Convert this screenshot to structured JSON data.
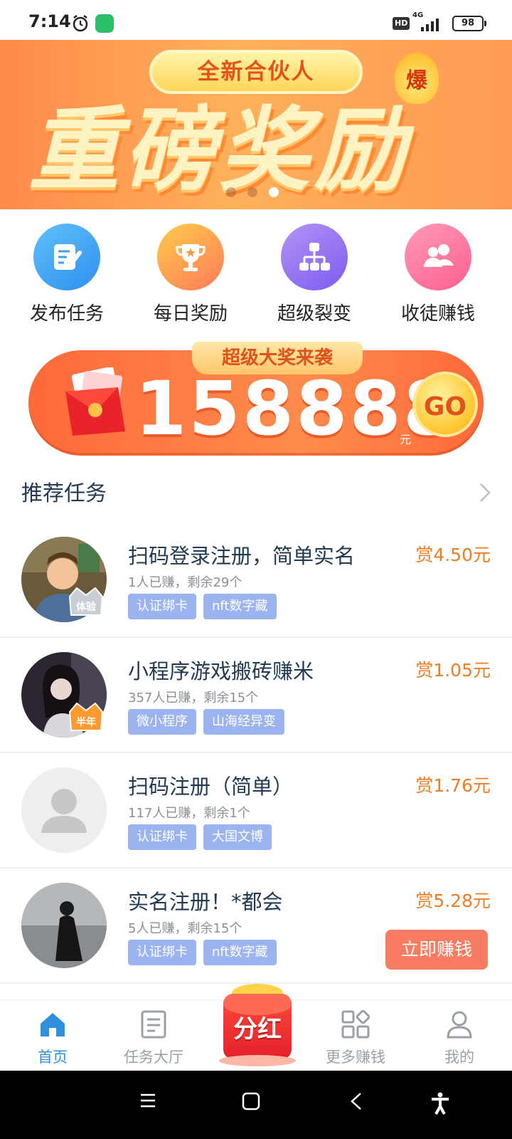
{
  "status_bar": {
    "time": "7:14",
    "hd": "HD",
    "network": "4G",
    "battery": "98"
  },
  "banner": {
    "ribbon": "全新合伙人",
    "burst": "爆",
    "headline": "重磅奖励"
  },
  "quick_menu": [
    {
      "label": "发布任务",
      "icon": "edit-note-icon",
      "color_from": "#5fc1f7",
      "color_to": "#2f8ff0"
    },
    {
      "label": "每日奖励",
      "icon": "trophy-icon",
      "color_from": "#ffcc4a",
      "color_to": "#ff7a5a"
    },
    {
      "label": "超级裂变",
      "icon": "network-icon",
      "color_from": "#b493f5",
      "color_to": "#7c5cf0"
    },
    {
      "label": "收徒赚钱",
      "icon": "users-icon",
      "color_from": "#ff9ab8",
      "color_to": "#ff5f8f"
    }
  ],
  "jackpot": {
    "tag": "超级大奖来袭",
    "amount": "158888",
    "unit": "元",
    "go": "GO"
  },
  "section": {
    "title": "推荐任务"
  },
  "tasks": [
    {
      "title": "扫码登录注册，简单实名",
      "meta": "1人已赚，剩余29个",
      "tags": [
        "认证绑卡",
        "nft数字藏"
      ],
      "reward": "赏4.50元",
      "badge": "体验"
    },
    {
      "title": "小程序游戏搬砖赚米",
      "meta": "357人已赚，剩余15个",
      "tags": [
        "微小程序",
        "山海经异变"
      ],
      "reward": "赏1.05元",
      "badge": "半年"
    },
    {
      "title": "扫码注册（简单）",
      "meta": "117人已赚，剩余1个",
      "tags": [
        "认证绑卡",
        "大国文博"
      ],
      "reward": "赏1.76元",
      "badge": ""
    },
    {
      "title": "实名注册！*都会",
      "meta": "5人已赚，剩余15个",
      "tags": [
        "认证绑卡",
        "nft数字藏"
      ],
      "reward": "赏5.28元",
      "badge": "",
      "cta": "立即赚钱"
    }
  ],
  "bottom_nav": [
    {
      "label": "首页",
      "icon": "home-icon",
      "active": true
    },
    {
      "label": "任务大厅",
      "icon": "document-icon",
      "active": false
    },
    {
      "label": "分红",
      "icon": "red-envelope-icon",
      "active": false
    },
    {
      "label": "更多赚钱",
      "icon": "grid-icon",
      "active": false
    },
    {
      "label": "我的",
      "icon": "person-icon",
      "active": false
    }
  ],
  "colors": {
    "accent": "#2f8fe0",
    "reward": "#ee7d23",
    "tag_bg": "#9bb4ef",
    "cta": "#f77c62"
  }
}
